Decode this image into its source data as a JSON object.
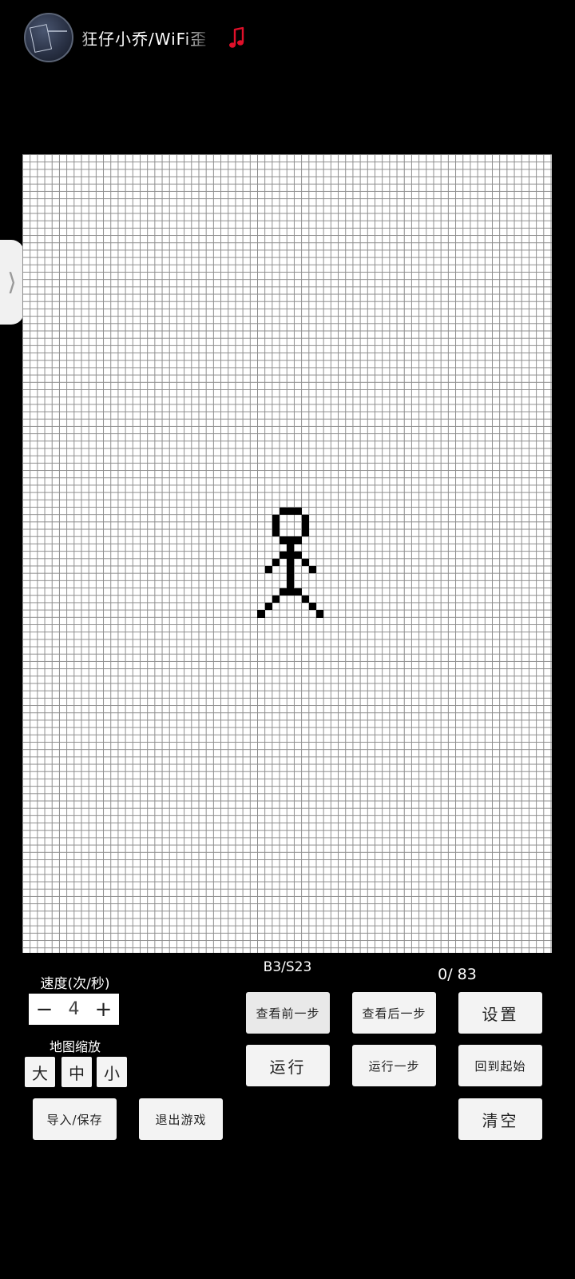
{
  "music": {
    "song_title": "狂仔小乔/WiFi歪",
    "note_icon": "music-note-icon",
    "note_color": "#e0102a"
  },
  "side_tab": {
    "icon": "chevron-right-icon",
    "glyph": "⟩"
  },
  "game": {
    "rule": "B3/S23",
    "generation": "0/ 83",
    "grid_color": "#8c8c8c",
    "live_cell_color": "#000000",
    "live_cells": [
      [
        35,
        48
      ],
      [
        36,
        48
      ],
      [
        37,
        48
      ],
      [
        34,
        49
      ],
      [
        38,
        49
      ],
      [
        34,
        50
      ],
      [
        38,
        50
      ],
      [
        34,
        51
      ],
      [
        38,
        51
      ],
      [
        35,
        52
      ],
      [
        36,
        52
      ],
      [
        37,
        52
      ],
      [
        36,
        53
      ],
      [
        35,
        54
      ],
      [
        36,
        54
      ],
      [
        37,
        54
      ],
      [
        34,
        55
      ],
      [
        36,
        55
      ],
      [
        38,
        55
      ],
      [
        33,
        56
      ],
      [
        36,
        56
      ],
      [
        39,
        56
      ],
      [
        36,
        57
      ],
      [
        36,
        58
      ],
      [
        35,
        59
      ],
      [
        36,
        59
      ],
      [
        37,
        59
      ],
      [
        34,
        60
      ],
      [
        38,
        60
      ],
      [
        33,
        61
      ],
      [
        39,
        61
      ],
      [
        32,
        62
      ],
      [
        40,
        62
      ]
    ]
  },
  "controls": {
    "speed_label": "速度(次/秒)",
    "minus": "−",
    "speed_value": "4",
    "plus": "+",
    "zoom_label": "地图缩放",
    "zoom_large": "大",
    "zoom_medium": "中",
    "zoom_small": "小",
    "prev_step": "查看前一步",
    "next_step": "查看后一步",
    "settings": "设置",
    "run": "运行",
    "run_one_step": "运行一步",
    "back_to_start": "回到起始",
    "import_save": "导入/保存",
    "exit_game": "退出游戏",
    "clear": "清空"
  }
}
